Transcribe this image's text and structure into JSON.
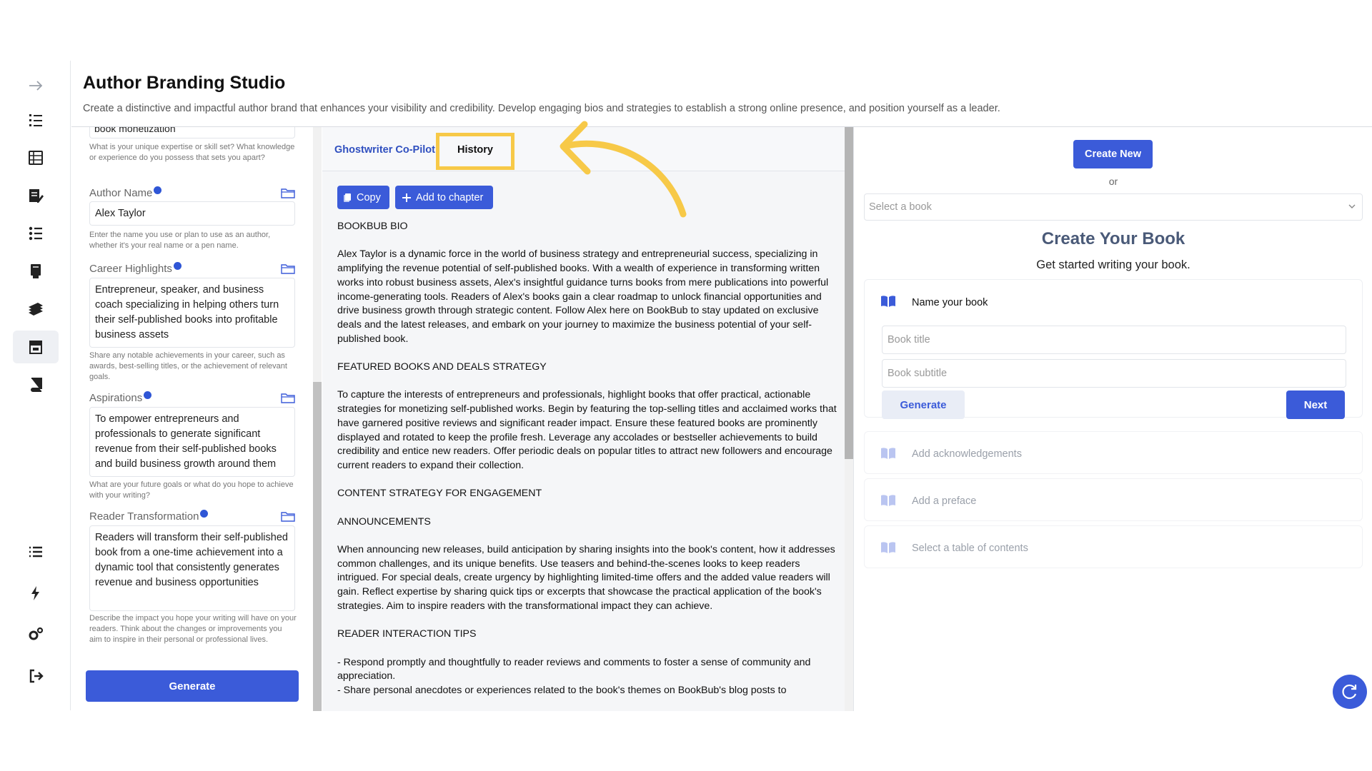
{
  "header": {
    "title": "Author Branding Studio",
    "subtitle": "Create a distinctive and impactful author brand that enhances your visibility and credibility. Develop engaging bios and strategies to establish a strong online presence, and position yourself as a leader."
  },
  "rail": {
    "items": [
      "arrow-right-icon",
      "numbered-list-icon",
      "table-icon",
      "edit-note-icon",
      "checklist-icon",
      "book-stand-icon",
      "books-stack-icon",
      "storefront-icon",
      "book-icon",
      "list-icon",
      "bolt-icon",
      "settings-icon",
      "logout-icon"
    ],
    "active": "storefront-icon"
  },
  "form": {
    "prev_value": "book monetization",
    "expertise_help": "What is your unique expertise or skill set? What knowledge or experience do you possess that sets you apart?",
    "author_name": {
      "label": "Author Name",
      "value": "Alex Taylor",
      "help": "Enter the name you use or plan to use as an author, whether it's your real name or a pen name."
    },
    "career": {
      "label": "Career Highlights",
      "value": "Entrepreneur, speaker, and business coach specializing in helping others turn their self-published books into profitable business assets",
      "help": "Share any notable achievements in your career, such as awards, best-selling titles, or the achievement of relevant goals."
    },
    "aspirations": {
      "label": "Aspirations",
      "value": "To empower entrepreneurs and professionals to generate significant revenue from their self-published books and build business growth around them",
      "help": "What are your future goals or what do you hope to achieve with your writing?"
    },
    "reader": {
      "label": "Reader Transformation",
      "value": "Readers will transform their self-published book from a one-time achievement into a dynamic tool that consistently generates revenue and business opportunities",
      "help": "Describe the impact you hope your writing will have on your readers. Think about the changes or improvements you aim to inspire in their personal or professional lives."
    },
    "generate_label": "Generate"
  },
  "middle": {
    "tabs": [
      "Ghostwriter Co-Pilot",
      "History"
    ],
    "copy_label": "Copy",
    "add_label": "Add to chapter",
    "paragraphs": [
      "BOOKBUB BIO",
      "Alex Taylor is a dynamic force in the world of business strategy and entrepreneurial success, specializing in amplifying the revenue potential of self-published books. With a wealth of experience in transforming written works into robust business assets, Alex's insightful guidance turns books from mere publications into powerful income-generating tools. Readers of Alex's books gain a clear roadmap to unlock financial opportunities and drive business growth through strategic content. Follow Alex here on BookBub to stay updated on exclusive deals and the latest releases, and embark on your journey to maximize the business potential of your self-published book.",
      "FEATURED BOOKS AND DEALS STRATEGY",
      "To capture the interests of entrepreneurs and professionals, highlight books that offer practical, actionable strategies for monetizing self-published works. Begin by featuring the top-selling titles and acclaimed works that have garnered positive reviews and significant reader impact. Ensure these featured books are prominently displayed and rotated to keep the profile fresh. Leverage any accolades or bestseller achievements to build credibility and entice new readers. Offer periodic deals on popular titles to attract new followers and encourage current readers to expand their collection.",
      "CONTENT STRATEGY FOR ENGAGEMENT",
      "ANNOUNCEMENTS",
      "When announcing new releases, build anticipation by sharing insights into the book's content, how it addresses common challenges, and its unique benefits. Use teasers and behind-the-scenes looks to keep readers intrigued. For special deals, create urgency by highlighting limited-time offers and the added value readers will gain. Reflect expertise by sharing quick tips or excerpts that showcase the practical application of the book's strategies. Aim to inspire readers with the transformational impact they can achieve.",
      "READER INTERACTION TIPS",
      "- Respond promptly and thoughtfully to reader reviews and comments to foster a sense of community and appreciation.\n- Share personal anecdotes or experiences related to the book's themes on BookBub's blog posts to"
    ]
  },
  "right": {
    "create_new_label": "Create New",
    "or_text": "or",
    "select_placeholder": "Select a book",
    "title": "Create Your Book",
    "subtitle": "Get started writing your book.",
    "step_name_label": "Name your book",
    "book_title_placeholder": "Book title",
    "book_subtitle_placeholder": "Book subtitle",
    "generate_label": "Generate",
    "next_label": "Next",
    "steps": [
      "Add acknowledgements",
      "Add a preface",
      "Select a table of contents"
    ]
  },
  "colors": {
    "primary": "#3b5bd9",
    "highlight": "#f7c948"
  }
}
